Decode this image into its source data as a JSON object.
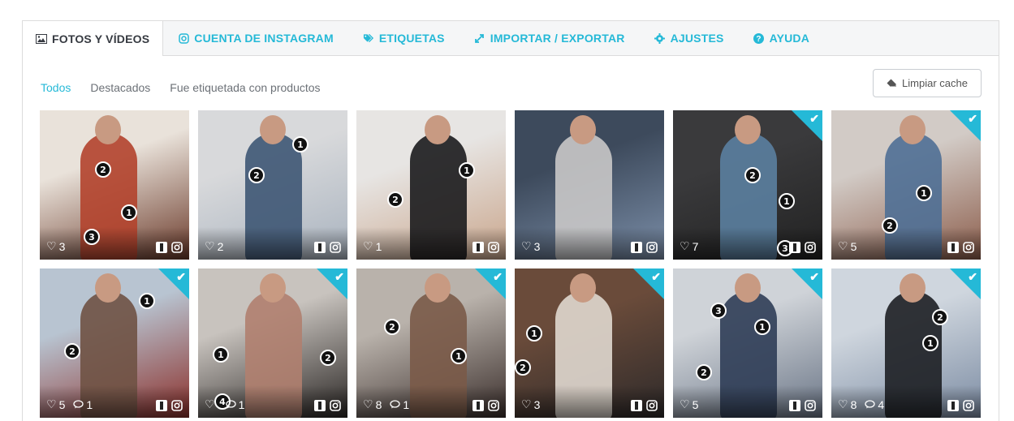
{
  "tabs": [
    {
      "label": "FOTOS Y VÍDEOS",
      "icon": "image-icon",
      "active": true
    },
    {
      "label": "CUENTA DE INSTAGRAM",
      "icon": "instagram-icon",
      "active": false
    },
    {
      "label": "ETIQUETAS",
      "icon": "tags-icon",
      "active": false
    },
    {
      "label": "IMPORTAR / EXPORTAR",
      "icon": "import-export-icon",
      "active": false
    },
    {
      "label": "AJUSTES",
      "icon": "gear-icon",
      "active": false
    },
    {
      "label": "AYUDA",
      "icon": "help-icon",
      "active": false
    }
  ],
  "filters": [
    {
      "label": "Todos",
      "active": true
    },
    {
      "label": "Destacados",
      "active": false
    },
    {
      "label": "Fue etiquetada con productos",
      "active": false
    }
  ],
  "clear_cache_label": "Limpiar cache",
  "accent": "#25b9d7",
  "posts": [
    {
      "likes": "3",
      "comments": null,
      "featured": false,
      "tags": [
        "2",
        "1",
        "3"
      ]
    },
    {
      "likes": "2",
      "comments": null,
      "featured": false,
      "tags": [
        "1",
        "2"
      ]
    },
    {
      "likes": "1",
      "comments": null,
      "featured": false,
      "tags": [
        "1",
        "2"
      ]
    },
    {
      "likes": "3",
      "comments": null,
      "featured": false,
      "tags": []
    },
    {
      "likes": "7",
      "comments": null,
      "featured": true,
      "tags": [
        "2",
        "1",
        "3"
      ]
    },
    {
      "likes": "5",
      "comments": null,
      "featured": true,
      "tags": [
        "1",
        "2"
      ]
    },
    {
      "likes": "5",
      "comments": "1",
      "featured": true,
      "tags": [
        "1",
        "2"
      ]
    },
    {
      "likes": "",
      "comments": "1",
      "featured": true,
      "tags": [
        "1",
        "2",
        "4"
      ]
    },
    {
      "likes": "8",
      "comments": "1",
      "featured": true,
      "tags": [
        "2",
        "1"
      ]
    },
    {
      "likes": "3",
      "comments": null,
      "featured": true,
      "tags": [
        "1",
        "2"
      ]
    },
    {
      "likes": "5",
      "comments": null,
      "featured": true,
      "tags": [
        "3",
        "1",
        "2"
      ]
    },
    {
      "likes": "8",
      "comments": "4",
      "featured": true,
      "tags": [
        "2",
        "1"
      ]
    }
  ]
}
